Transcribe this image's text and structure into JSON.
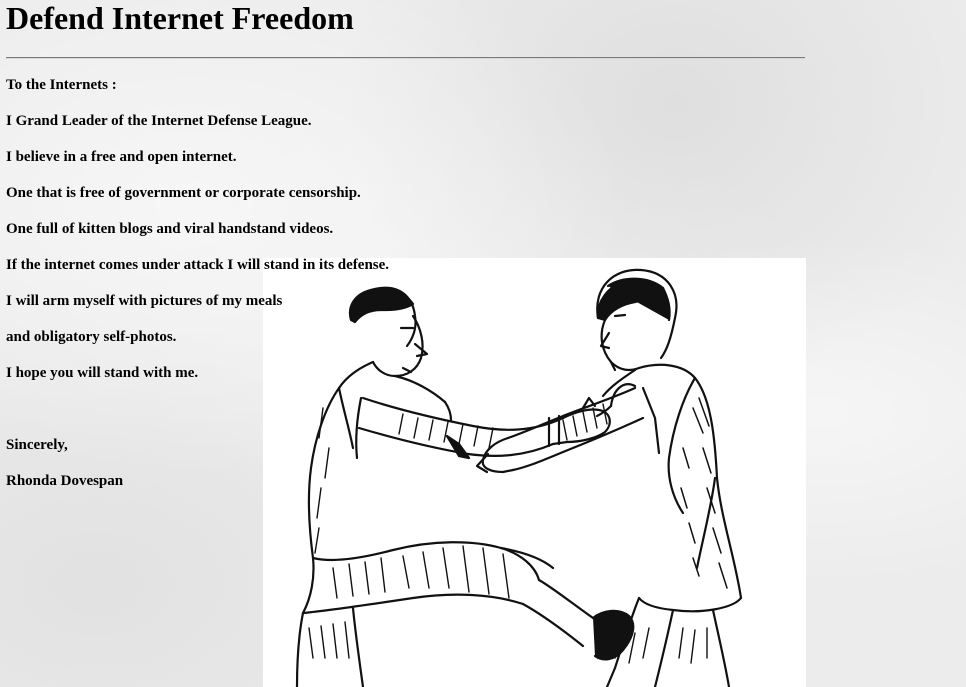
{
  "page": {
    "title": "Defend Internet Freedom"
  },
  "letter": {
    "salutation": "To the Internets :",
    "lines": [
      "I Grand Leader of the Internet Defense League.",
      "I believe in a free and open internet.",
      "One that is free of government or corporate censorship.",
      "One full of kitten blogs and viral handstand videos.",
      "If the internet comes under attack I will stand in its defense.",
      "I will arm myself with pictures of my meals",
      "and obligatory self-photos.",
      "I hope you will stand with me."
    ],
    "closing": "Sincerely,",
    "signature": "Rhonda Dovespan"
  },
  "illustration": {
    "icon": "two-men-grappling-engraving"
  }
}
